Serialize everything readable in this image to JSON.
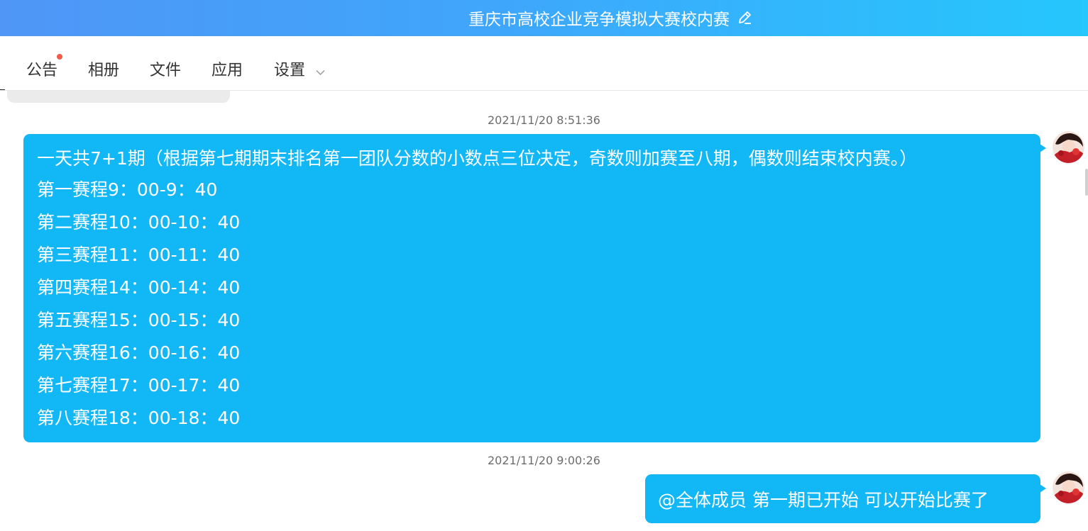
{
  "header": {
    "title": "重庆市高校企业竞争模拟大赛校内赛",
    "edit_icon": "pencil-icon"
  },
  "tabs": [
    {
      "label": "公告",
      "has_notification_dot": true
    },
    {
      "label": "相册"
    },
    {
      "label": "文件"
    },
    {
      "label": "应用"
    },
    {
      "label": "设置",
      "has_dropdown": true
    }
  ],
  "messages": [
    {
      "timestamp": "2021/11/20 8:51:36",
      "lines": [
        "一天共7+1期（根据第七期期末排名第一团队分数的小数点三位决定，奇数则加赛至八期，偶数则结束校内赛。）",
        "第一赛程9：00-9：40",
        "第二赛程10：00-10：40",
        "第三赛程11：00-11：40",
        "第四赛程14：00-14：40",
        "第五赛程15：00-15：40",
        "第六赛程16：00-16：40",
        "第七赛程17：00-17：40",
        "第八赛程18：00-18：40"
      ]
    },
    {
      "timestamp": "2021/11/20 9:00:26",
      "text": "@全体成员 第一期已开始 可以开始比赛了"
    }
  ],
  "colors": {
    "bubble": "#12b7f5",
    "header_gradient_start": "#4f96f7",
    "header_gradient_end": "#25c7fd",
    "notification_dot": "#f25b4a"
  }
}
